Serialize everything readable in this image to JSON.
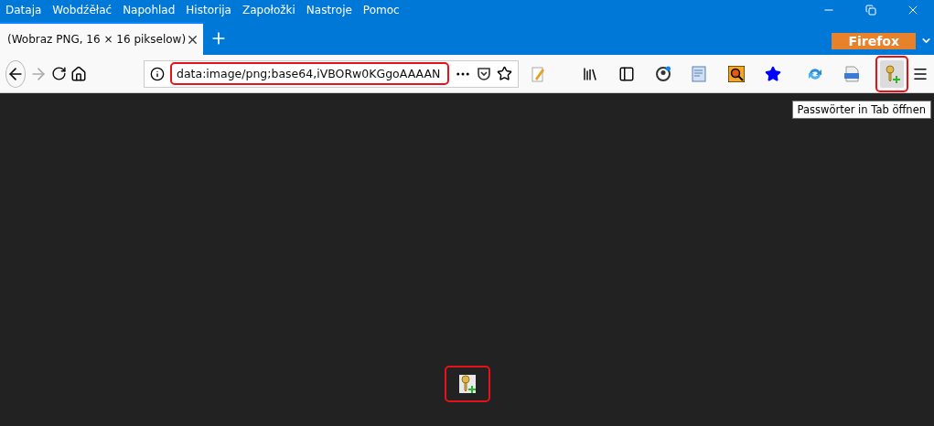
{
  "menu_bar": {
    "items": [
      "Dataja",
      "Wobdźěłać",
      "Napohlad",
      "Historija",
      "Zapołožki",
      "Nastroje",
      "Pomoc"
    ]
  },
  "tabs": [
    {
      "label": "(Wobraz PNG, 16 × 16 pikselow)",
      "selected": true
    }
  ],
  "brand_badge": "Firefox",
  "address_bar": {
    "value": "data:image/png;base64,iVBORw0KGgoAAAAN",
    "highlighted": true
  },
  "toolbar_extensions": [
    {
      "kind": "pencil",
      "highlighted": false
    },
    {
      "kind": "library",
      "highlighted": false
    },
    {
      "kind": "sidebar",
      "highlighted": false
    },
    {
      "kind": "account",
      "highlighted": false
    },
    {
      "kind": "form",
      "highlighted": false
    },
    {
      "kind": "magnifier",
      "highlighted": false
    },
    {
      "kind": "star",
      "highlighted": false
    },
    {
      "kind": "sync",
      "highlighted": false
    },
    {
      "kind": "css",
      "highlighted": false
    },
    {
      "kind": "key",
      "highlighted": true
    }
  ],
  "tooltip": "Passwörter in Tab öffnen",
  "content": {
    "image_highlighted": true
  }
}
